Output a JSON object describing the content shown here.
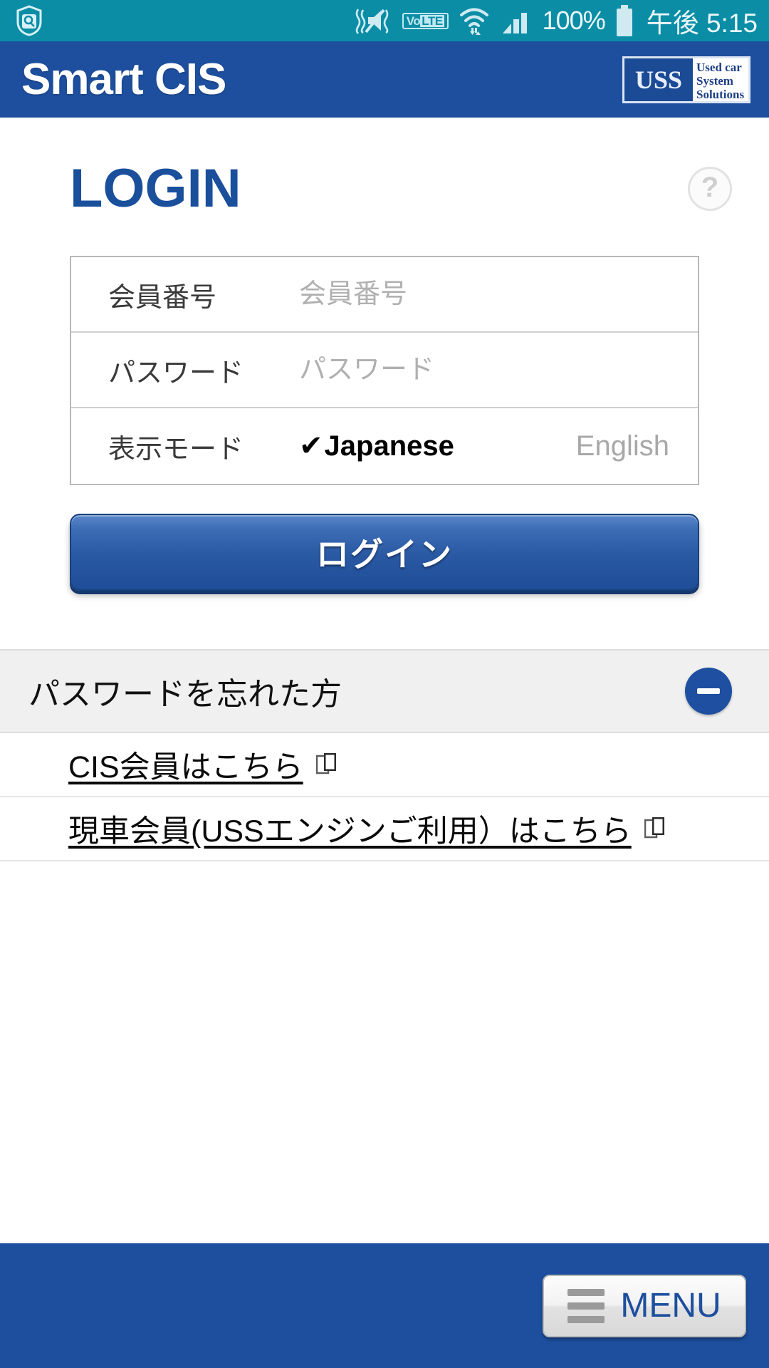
{
  "statusbar": {
    "shield_icon": "security-shield-icon",
    "mute_icon": "vibrate-mute-icon",
    "volte_prefix": "Vo",
    "volte_suffix": "LTE",
    "wifi_icon": "wifi-icon",
    "signal_icon": "cellular-signal-icon",
    "battery_percent": "100%",
    "battery_icon": "battery-full-icon",
    "clock": "午後 5:15"
  },
  "appbar": {
    "brand": "Smart CIS",
    "logo": {
      "mark": "USS",
      "line1": "Used car",
      "line2": "System",
      "line3": "Solutions"
    }
  },
  "login": {
    "title": "LOGIN",
    "help_label": "?",
    "fields": [
      {
        "label": "会員番号",
        "value": "",
        "placeholder": "会員番号"
      },
      {
        "label": "パスワード",
        "value": "",
        "placeholder": "パスワード"
      }
    ],
    "display_mode": {
      "label": "表示モード",
      "check": "✔",
      "selected": "Japanese",
      "other": "English"
    },
    "submit_label": "ログイン"
  },
  "forgot": {
    "header": "パスワードを忘れた方",
    "expanded": true,
    "links": [
      {
        "text": "CIS会員はこちら",
        "icon": "external-link-icon"
      },
      {
        "text": "現車会員(USSエンジンご利用）はこちら",
        "icon": "external-link-icon"
      }
    ]
  },
  "footer": {
    "menu_label": "MENU"
  },
  "colors": {
    "status_bar": "#0b8da6",
    "header_blue": "#1d4f9e",
    "title_blue": "#1a4f9c",
    "accent_blue": "#1e4fa0",
    "panel_gray": "#f0f0f0"
  }
}
